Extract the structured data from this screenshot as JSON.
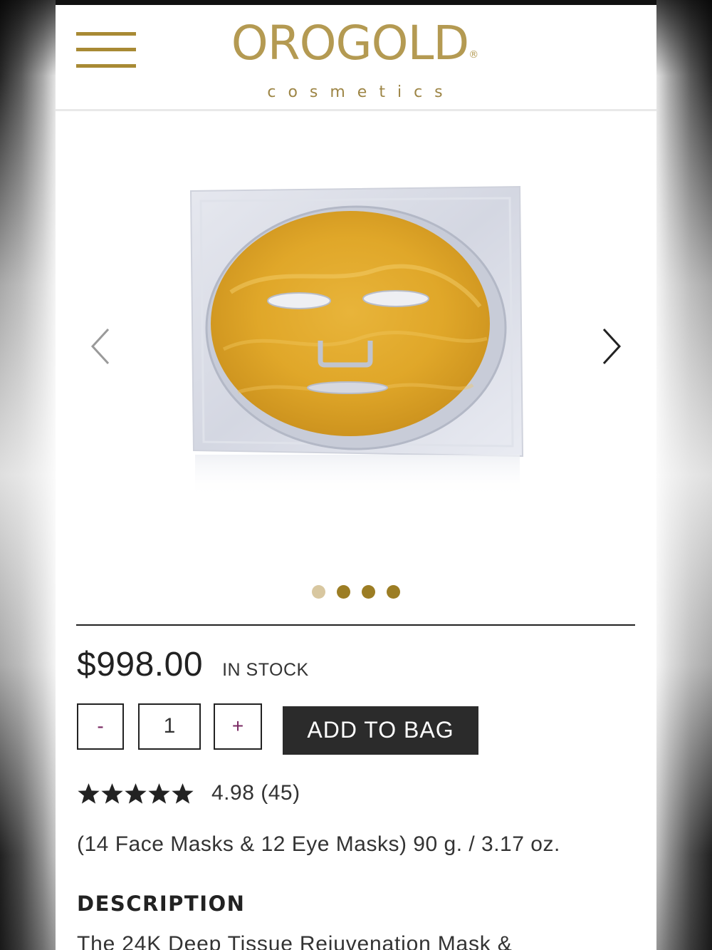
{
  "header": {
    "menu_icon": "hamburger-menu-icon",
    "logo_main": "OROGOLD",
    "logo_mark": "®",
    "logo_sub": "cosmetics"
  },
  "carousel": {
    "prev_icon": "chevron-left-icon",
    "next_icon": "chevron-right-icon",
    "slide_count": 4,
    "active_slide": 1
  },
  "product": {
    "price": "$998.00",
    "stock_status": "IN STOCK",
    "quantity": {
      "minus_label": "-",
      "value": "1",
      "plus_label": "+"
    },
    "add_to_bag_label": "ADD TO BAG",
    "rating": {
      "stars": 5,
      "score_text": "4.98 (45)"
    },
    "size_text": "(14 Face Masks & 12 Eye Masks) 90 g. / 3.17 oz.",
    "description_heading": "DESCRIPTION",
    "description_text": "The 24K Deep Tissue Rejuvenation Mask &"
  },
  "colors": {
    "brand_gold": "#a88a34",
    "button_dark": "#2b2b2b",
    "qty_accent": "#7a2a63"
  }
}
